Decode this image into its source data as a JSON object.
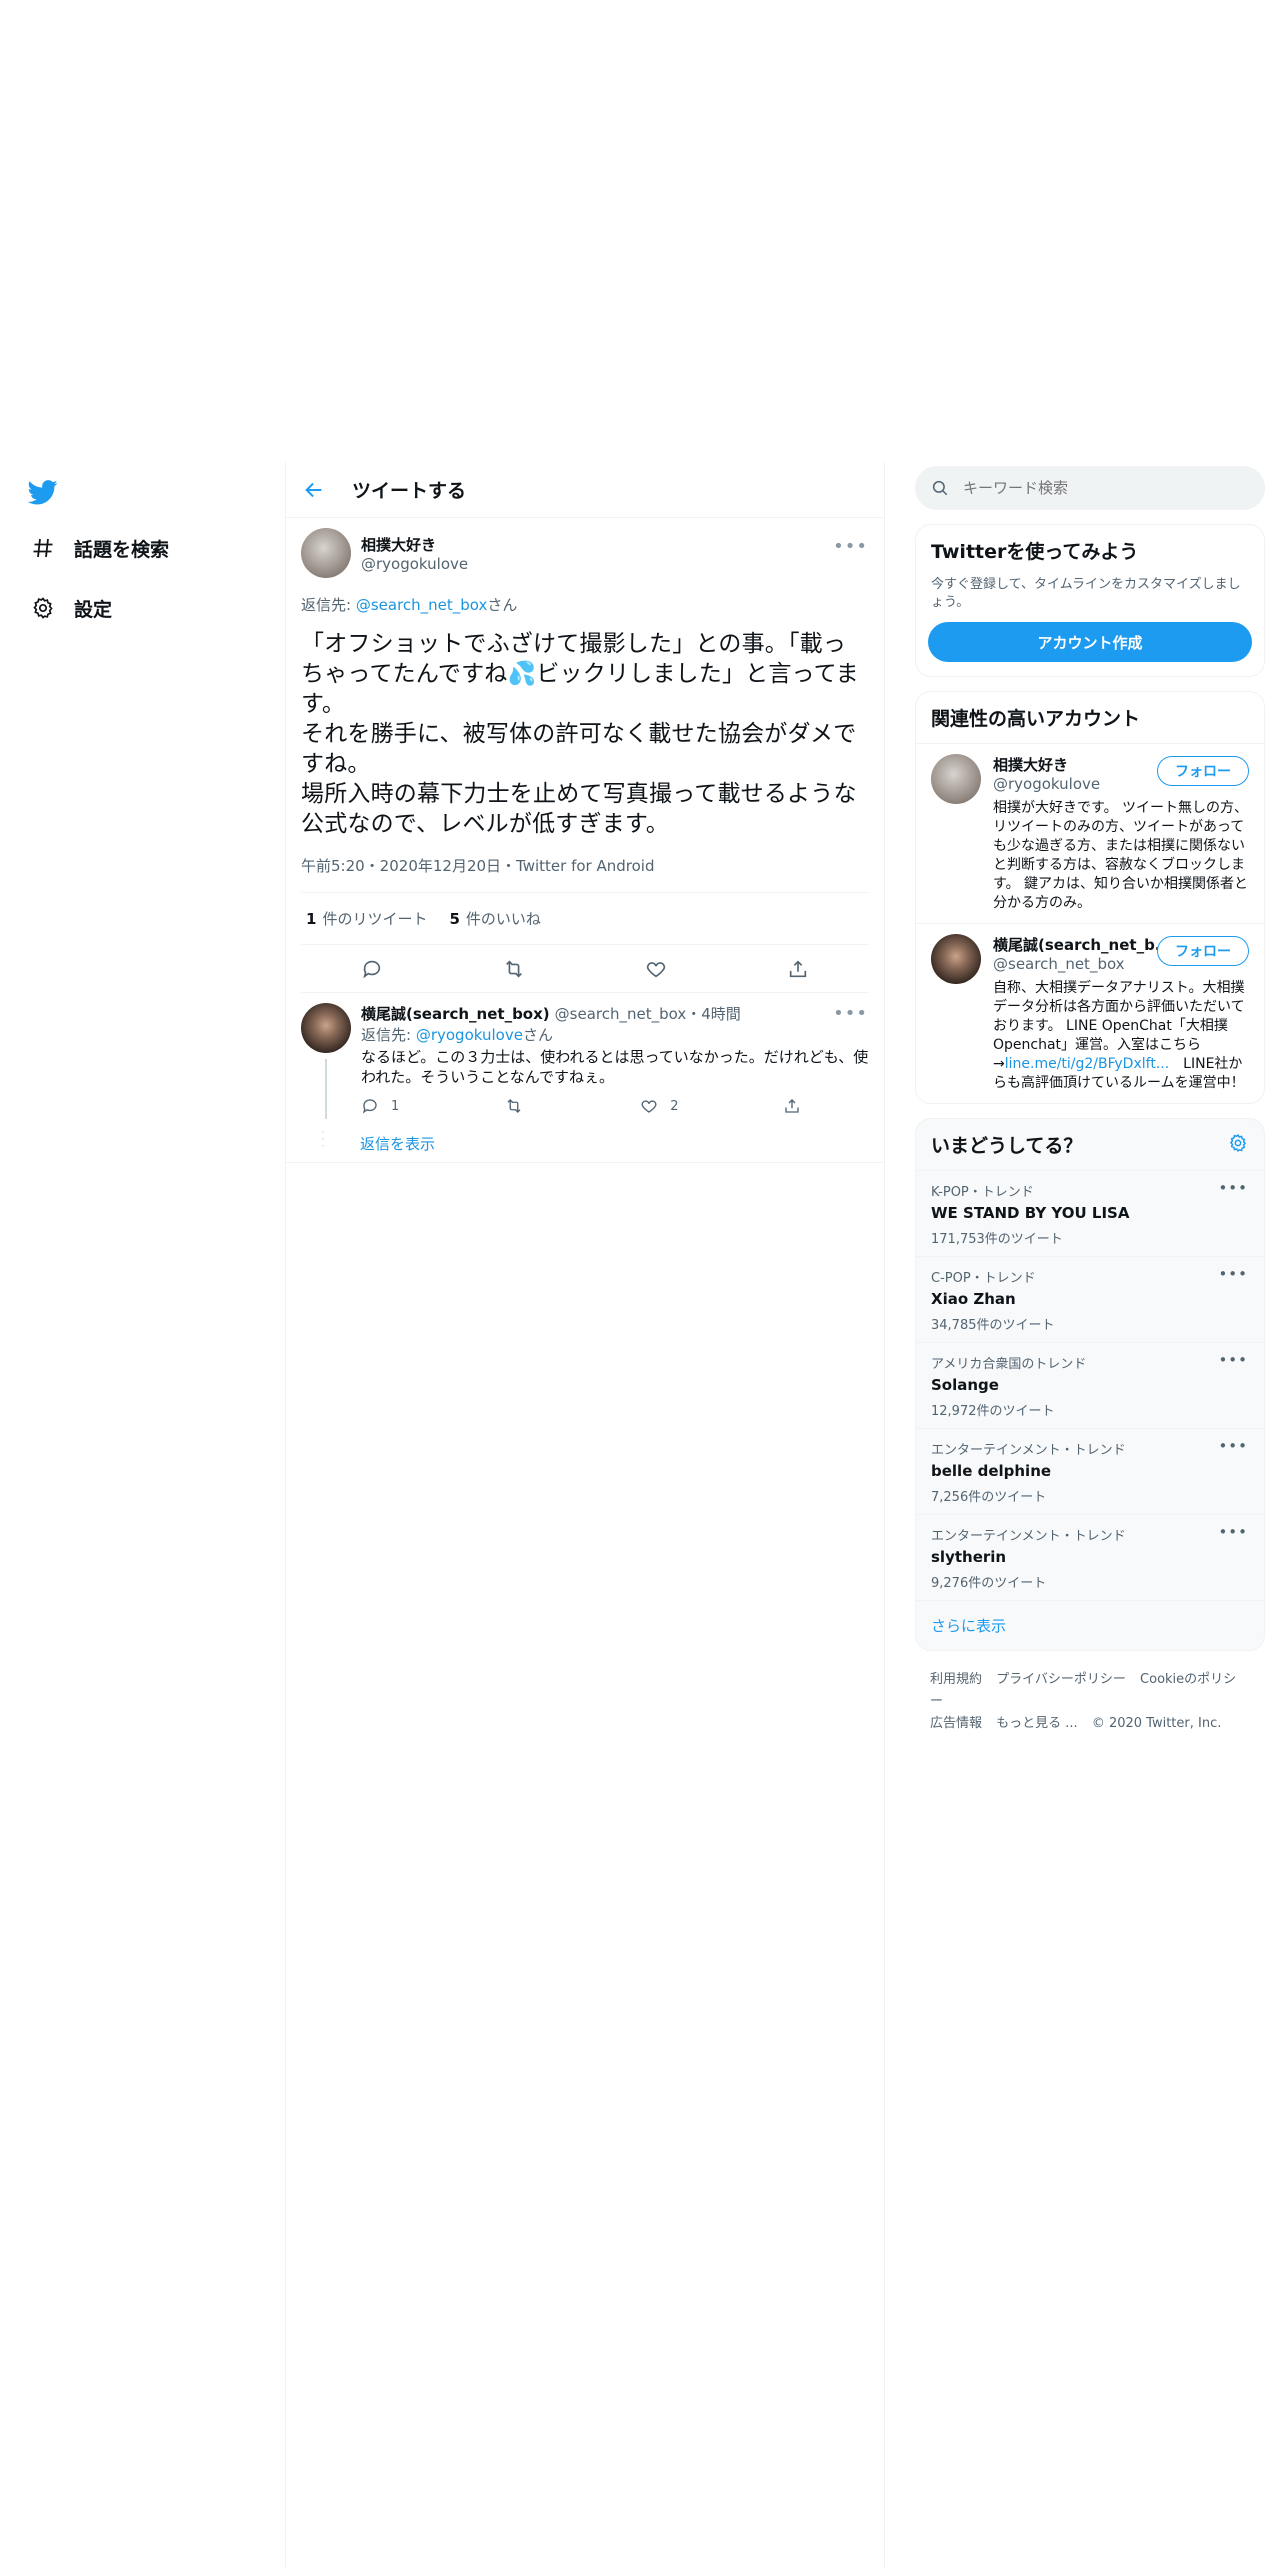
{
  "nav": {
    "items": [
      {
        "label": "話題を検索",
        "icon": "hashtag-icon"
      },
      {
        "label": "設定",
        "icon": "gear-icon"
      }
    ]
  },
  "main": {
    "title": "ツイートする",
    "tweet": {
      "name": "相撲大好き",
      "handle": "@ryogokulove",
      "reply_prefix": "返信先: ",
      "reply_to": "@search_net_box",
      "reply_suffix": "さん",
      "text_part1": "「オフショットでふざけて撮影した」との事。「載っちゃってたんですね",
      "emoji": "💦",
      "text_part2": "ビックリしました」と言ってます。\nそれを勝手に、被写体の許可なく載せた協会がダメですね。\n場所入時の幕下力士を止めて写真撮って載せるような公式なので、レベルが低すぎます。",
      "meta": "午前5:20・2020年12月20日・Twitter for Android",
      "retweets_num": "1",
      "retweets_label": "件のリツイート",
      "likes_num": "5",
      "likes_label": "件のいいね"
    },
    "reply": {
      "name": "横尾誠(search_net_box)",
      "handle": "@search_net_box",
      "time": "・4時間",
      "reply_prefix": "返信先: ",
      "reply_to": "@ryogokulove",
      "reply_suffix": "さん",
      "text": "なるほど。この３力士は、使われるとは思っていなかった。だけれども、使われた。そういうことなんですねぇ。",
      "reply_count": "1",
      "retweet_count": "",
      "like_count": "2",
      "show_replies": "返信を表示"
    }
  },
  "side": {
    "search_placeholder": "キーワード検索",
    "signup": {
      "title": "Twitterを使ってみよう",
      "desc": "今すぐ登録して、タイムラインをカスタマイズしましょう。",
      "button": "アカウント作成"
    },
    "related": {
      "title": "関連性の高いアカウント",
      "follow_label": "フォロー",
      "accounts": [
        {
          "name": "相撲大好き",
          "handle": "@ryogokulove",
          "bio": "相撲が大好きです。 ツイート無しの方、リツイートのみの方、ツイートがあっても少な過ぎる方、または相撲に関係ないと判断する方は、容赦なくブロックします。 鍵アカは、知り合いか相撲関係者と分かる方のみ。"
        },
        {
          "name": "横尾誠(search_net_b...",
          "handle": "@search_net_box",
          "bio": "自称、大相撲データアナリスト。大相撲データ分析は各方面から評価いただいております。 LINE OpenChat「大相撲Openchat」運営。入室はこちら→",
          "bio_link": "line.me/ti/g2/BFyDxlft...",
          "bio_end": "　LINE社からも高評価頂けているルームを運営中！"
        }
      ]
    },
    "trends": {
      "title": "いまどうしてる？",
      "items": [
        {
          "category": "K-POP・トレンド",
          "name": "WE STAND BY YOU LISA",
          "count": "171,753件のツイート"
        },
        {
          "category": "C-POP・トレンド",
          "name": "Xiao Zhan",
          "count": "34,785件のツイート"
        },
        {
          "category": "アメリカ合衆国のトレンド",
          "name": "Solange",
          "count": "12,972件のツイート"
        },
        {
          "category": "エンターテインメント・トレンド",
          "name": "belle delphine",
          "count": "7,256件のツイート"
        },
        {
          "category": "エンターテインメント・トレンド",
          "name": "slytherin",
          "count": "9,276件のツイート"
        }
      ],
      "show_more": "さらに表示"
    },
    "footer": {
      "links": [
        "利用規約",
        "プライバシーポリシー",
        "Cookieのポリシー",
        "広告情報",
        "もっと見る ..."
      ],
      "copyright": "© 2020 Twitter, Inc."
    }
  },
  "colors": {
    "accent": "#1d9bf0",
    "link": "#1b95e0",
    "muted": "#536471"
  }
}
